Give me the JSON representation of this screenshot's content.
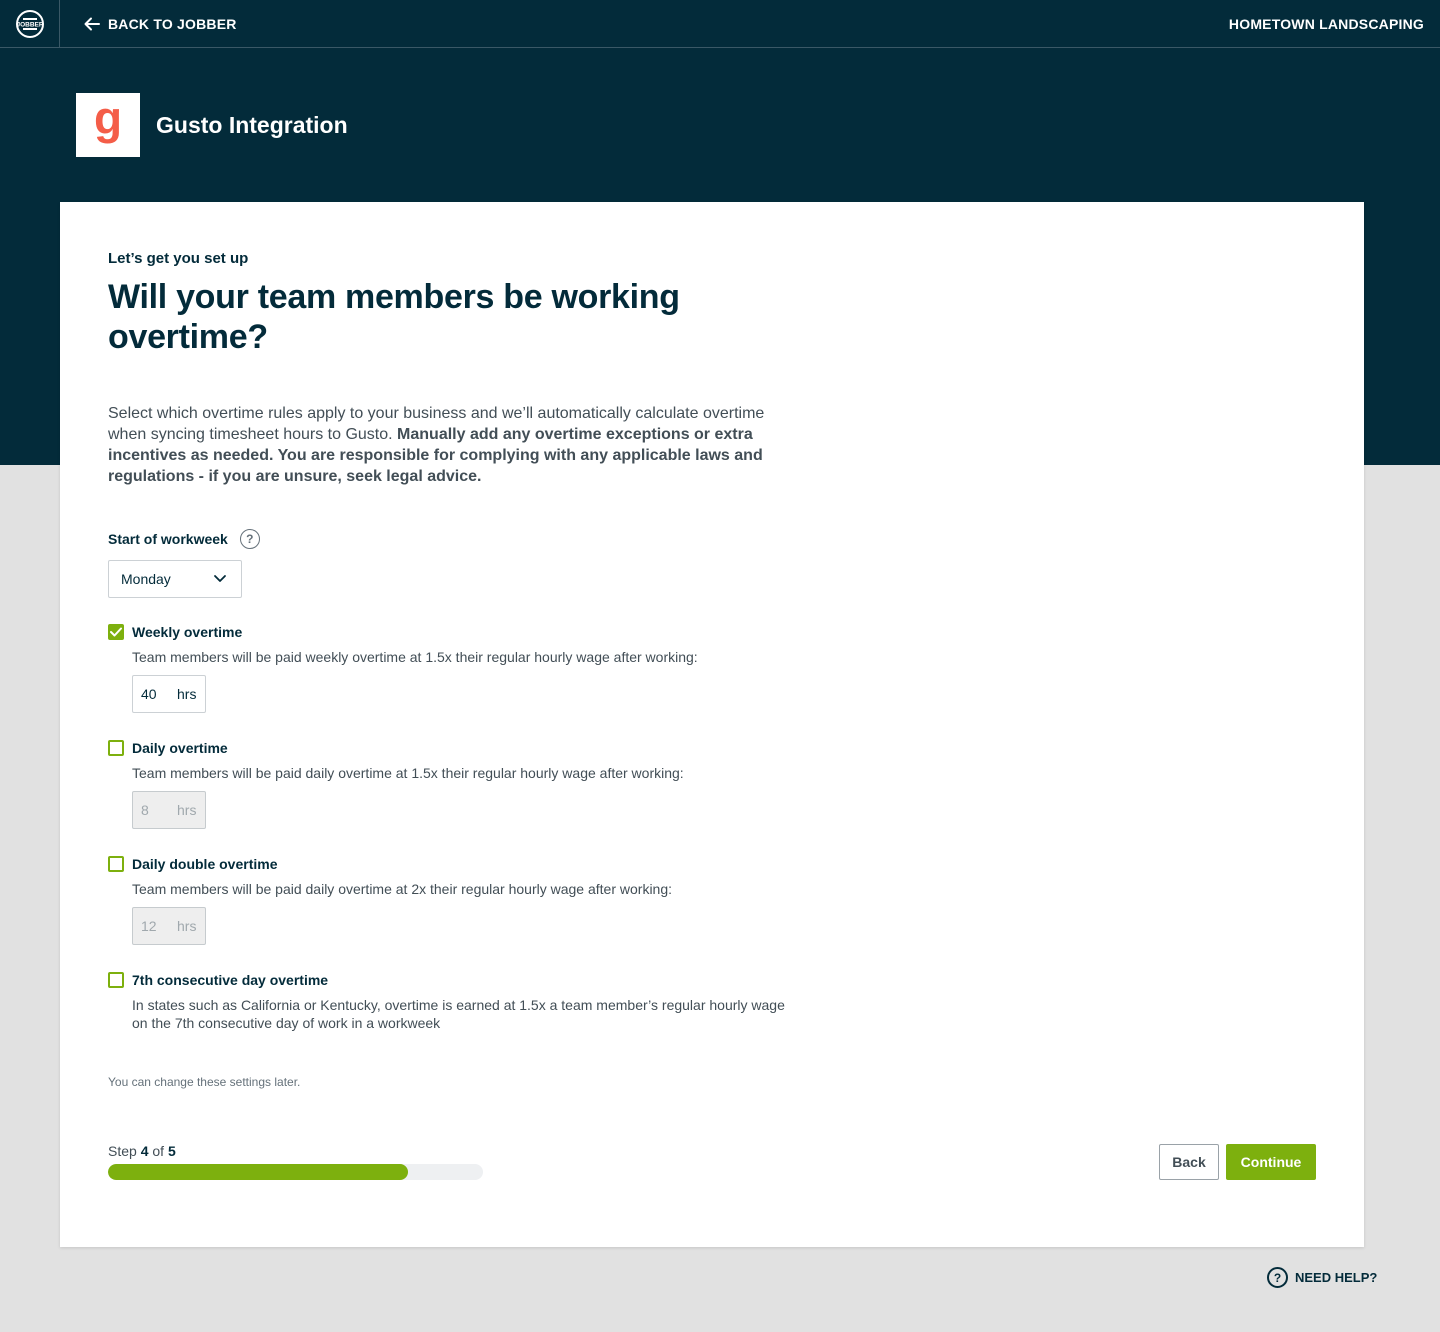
{
  "header": {
    "logo_text": "JOBBER",
    "back_label": "BACK TO JOBBER",
    "company_name": "HOMETOWN LANDSCAPING"
  },
  "integration": {
    "logo_letter": "g",
    "title": "Gusto Integration"
  },
  "main": {
    "eyebrow": "Let’s get you set up",
    "headline": "Will your team members be working overtime?",
    "intro_regular": "Select which overtime rules apply to your business and we’ll automatically calculate overtime when syncing timesheet hours to Gusto.",
    "intro_bold": "Manually add any overtime exceptions or extra incentives as needed. You are responsible for complying with any applicable laws and regulations - if you are unsure, seek legal advice.",
    "workweek": {
      "label": "Start of workweek",
      "help_glyph": "?",
      "selected": "Monday"
    },
    "options": [
      {
        "title": "Weekly overtime",
        "checked": true,
        "description": "Team members will be paid weekly overtime at 1.5x their regular hourly wage after working:",
        "hours": "40",
        "unit": "hrs",
        "enabled": true
      },
      {
        "title": "Daily overtime",
        "checked": false,
        "description": "Team members will be paid daily overtime at 1.5x their regular hourly wage after working:",
        "hours": "8",
        "unit": "hrs",
        "enabled": false
      },
      {
        "title": "Daily double overtime",
        "checked": false,
        "description": "Team members will be paid daily overtime at 2x their regular hourly wage after working:",
        "hours": "12",
        "unit": "hrs",
        "enabled": false
      },
      {
        "title": "7th consecutive day overtime",
        "checked": false,
        "description": "In states such as California or Kentucky, overtime is earned at 1.5x a team member’s regular hourly wage on the 7th consecutive day of work in a workweek"
      }
    ],
    "note": "You can change these settings later."
  },
  "footer": {
    "step_prefix": "Step",
    "step_current": "4",
    "step_of": "of",
    "step_total": "5",
    "progress_fraction": 0.8,
    "back_label": "Back",
    "continue_label": "Continue"
  },
  "help": {
    "label": "NEED HELP?",
    "glyph": "?"
  },
  "colors": {
    "navy": "#032b3a",
    "green": "#7db00e",
    "gusto": "#f45d48",
    "page_bg": "#e1e1e1"
  }
}
